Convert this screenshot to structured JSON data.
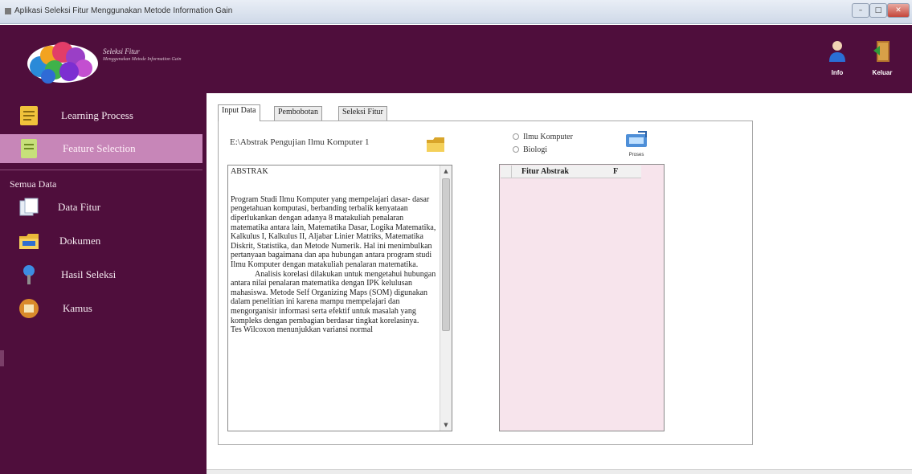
{
  "window": {
    "title": "Aplikasi Seleksi Fitur Menggunakan Metode Information Gain"
  },
  "header": {
    "logo_title": "Seleksi Fitur",
    "logo_subtitle": "Menggunakan Metode Information Gain",
    "buttons": [
      {
        "label": "Info",
        "icon": "user-icon"
      },
      {
        "label": "Keluar",
        "icon": "exit-door-icon"
      }
    ]
  },
  "sidebar": {
    "items": [
      {
        "label": "Learning Process",
        "icon": "notepad-icon",
        "active": false
      },
      {
        "label": "Feature Selection",
        "icon": "document-green-icon",
        "active": true
      }
    ],
    "section_label": "Semua Data",
    "data_items": [
      {
        "label": "Data Fitur",
        "icon": "pages-icon"
      },
      {
        "label": "Dokumen",
        "icon": "folder-icon"
      },
      {
        "label": "Hasil Seleksi",
        "icon": "pin-icon"
      },
      {
        "label": "Kamus",
        "icon": "book-icon"
      }
    ]
  },
  "tabs": [
    {
      "label": "Input Data",
      "active": true
    },
    {
      "label": "Pembobotan",
      "active": false
    },
    {
      "label": "Seleksi Fitur",
      "active": false
    }
  ],
  "input_panel": {
    "file_path": "E:\\Abstrak Pengujian Ilmu Komputer 1",
    "abstract_text": "ABSTRAK\n\n\nProgram Studi Ilmu Komputer yang mempelajari dasar- dasar pengetahuan komputasi, berbanding terbalik kenyataan diperlukankan dengan adanya 8 matakuliah penalaran matematika antara lain, Matematika Dasar, Logika Matematika, Kalkulus I, Kalkulus II, Aljabar Linier Matriks, Matematika Diskrit, Statistika, dan Metode Numerik. Hal ini menimbulkan pertanyaan bagaimana dan apa hubungan antara program studi Ilmu Komputer dengan matakuliah penalaran matematika.\n            Analisis korelasi dilakukan untuk mengetahui hubungan antara nilai penalaran matematika dengan IPK kelulusan mahasiswa. Metode Self Organizing Maps (SOM) digunakan dalam penelitian ini karena mampu mempelajari dan mengorganisir informasi serta efektif untuk masalah yang kompleks dengan pembagian berdasar tingkat korelasinya.\nTes Wilcoxon menunjukkan variansi normal",
    "categories": [
      {
        "label": "Ilmu Komputer",
        "selected": false
      },
      {
        "label": "Biologi",
        "selected": false
      }
    ],
    "process_button_label": "Proses",
    "grid_columns": [
      "Fitur Abstrak",
      "F"
    ]
  },
  "colors": {
    "header_bg": "#4f0e3c",
    "sidebar_active": "#c786b8",
    "grid_bg": "#f7e4ec"
  }
}
